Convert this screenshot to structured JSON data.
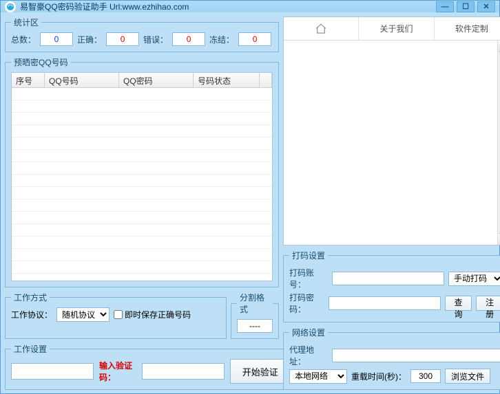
{
  "window": {
    "title": "易智豪QQ密码验证助手 Url:www.ezhihao.com"
  },
  "stats": {
    "legend": "统计区",
    "total_label": "总数：",
    "total_value": "0",
    "correct_label": "正确：",
    "correct_value": "0",
    "error_label": "错误：",
    "error_value": "0",
    "frozen_label": "冻结：",
    "frozen_value": "0"
  },
  "table": {
    "legend": "预晒密QQ号码",
    "col1": "序号",
    "col2": "QQ号码",
    "col3": "QQ密码",
    "col4": "号码状态"
  },
  "workmode": {
    "legend": "工作方式",
    "protocol_label": "工作协议：",
    "protocol_value": "随机协议",
    "save_label": "即时保存正确号码"
  },
  "split": {
    "legend": "分割格式",
    "value": "----"
  },
  "workset": {
    "legend": "工作设置",
    "captcha_label": "输入验证码：",
    "start_label": "开始验证"
  },
  "tabs": {
    "about": "关于我们",
    "custom": "软件定制"
  },
  "dama": {
    "legend": "打码设置",
    "account_label": "打码账号：",
    "mode_value": "手动打码",
    "password_label": "打码密码：",
    "query_label": "查询",
    "register_label": "注册"
  },
  "net": {
    "legend": "网络设置",
    "proxy_label": "代理地址：",
    "network_value": "本地网络",
    "reconnect_label": "重载时间(秒)：",
    "reconnect_value": "300",
    "browse_label": "浏览文件"
  }
}
